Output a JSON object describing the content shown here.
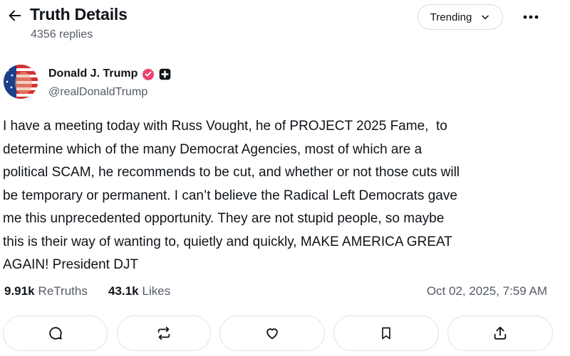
{
  "header": {
    "title": "Truth Details",
    "replies": "4356 replies",
    "sort_label": "Trending"
  },
  "post": {
    "author_name": "Donald J. Trump",
    "author_handle": "@realDonaldTrump",
    "body_lines": [
      "I have a meeting today with Russ Vought, he of PROJECT 2025 Fame,  to",
      "determine which of the many Democrat Agencies, most of which are a",
      "political SCAM, he recommends to be cut, and whether or not those cuts will",
      "be temporary or permanent. I can’t believe the Radical Left Democrats gave",
      "me this unprecedented opportunity. They are not stupid people, so maybe",
      "this is their way of wanting to, quietly and quickly, MAKE AMERICA GREAT",
      "AGAIN! President DJT"
    ],
    "retruths_count": "9.91k",
    "retruths_label": "ReTruths",
    "likes_count": "43.1k",
    "likes_label": "Likes",
    "timestamp": "Oct 02, 2025, 7:59 AM"
  },
  "icons": {
    "back": "arrow-left-icon",
    "sort": "chevron-down-icon",
    "more": "more-horizontal-icon",
    "verified": "verified-badge-icon",
    "plus": "truth-plus-badge-icon",
    "reply": "reply-icon",
    "retruth": "retruth-icon",
    "like": "heart-icon",
    "bookmark": "bookmark-icon",
    "share": "share-icon"
  },
  "colors": {
    "verified": "#e8436c",
    "text": "#0f1419",
    "muted": "#555b66",
    "border": "#dfe2e6"
  }
}
